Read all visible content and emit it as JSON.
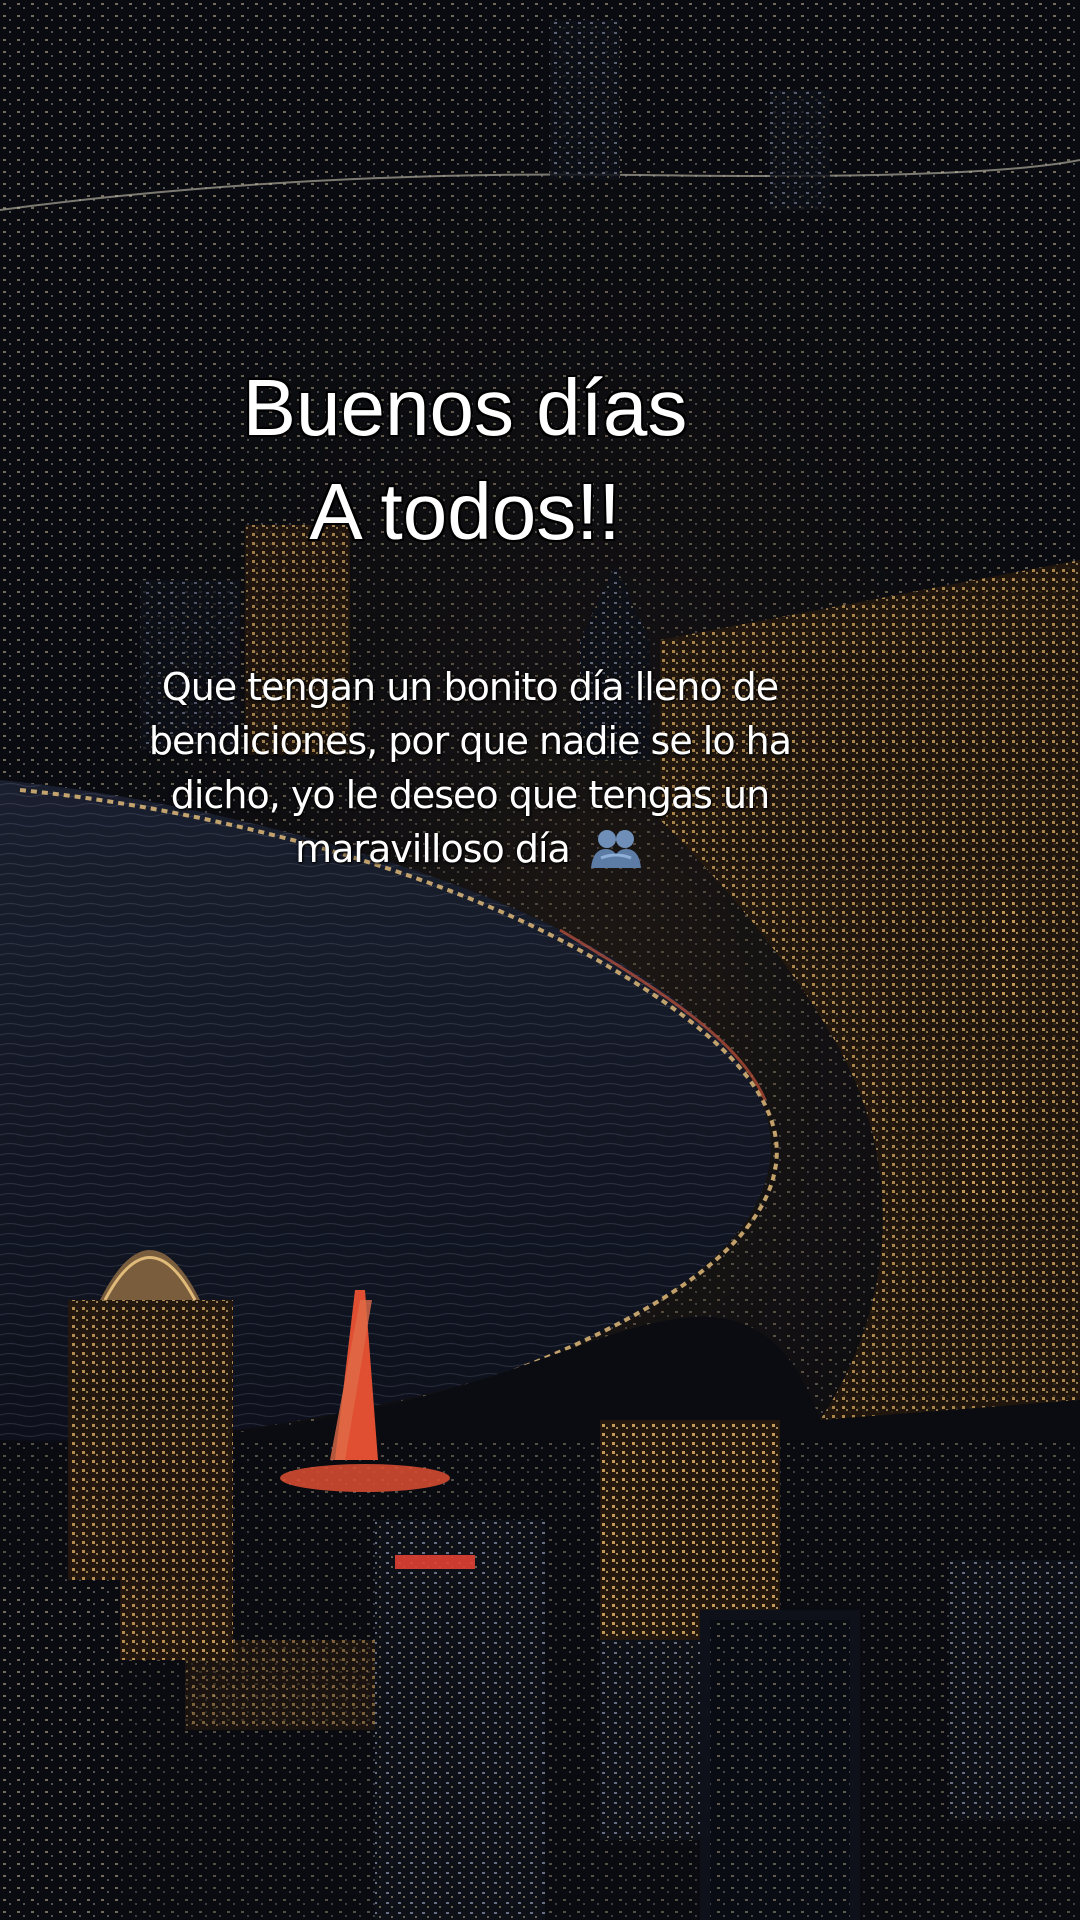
{
  "image": {
    "scene": "night-city-riverfront",
    "palette": {
      "sky_dark": "#07080d",
      "river": "#141a2a",
      "warm_light": "#f2b25a",
      "red_tower": "#ff5a3a",
      "text": "#ffffff",
      "text_outline": "#000000"
    }
  },
  "title": {
    "line1": "Buenos días",
    "line2": "A todos!!"
  },
  "caption": {
    "line1": "Que tengan un bonito día lleno de",
    "line2": "bendiciones, por que nadie se lo ha",
    "line3": "dicho, yo le deseo que tengas un",
    "line4": "maravilloso día",
    "emoji": "people-hugging-icon"
  }
}
